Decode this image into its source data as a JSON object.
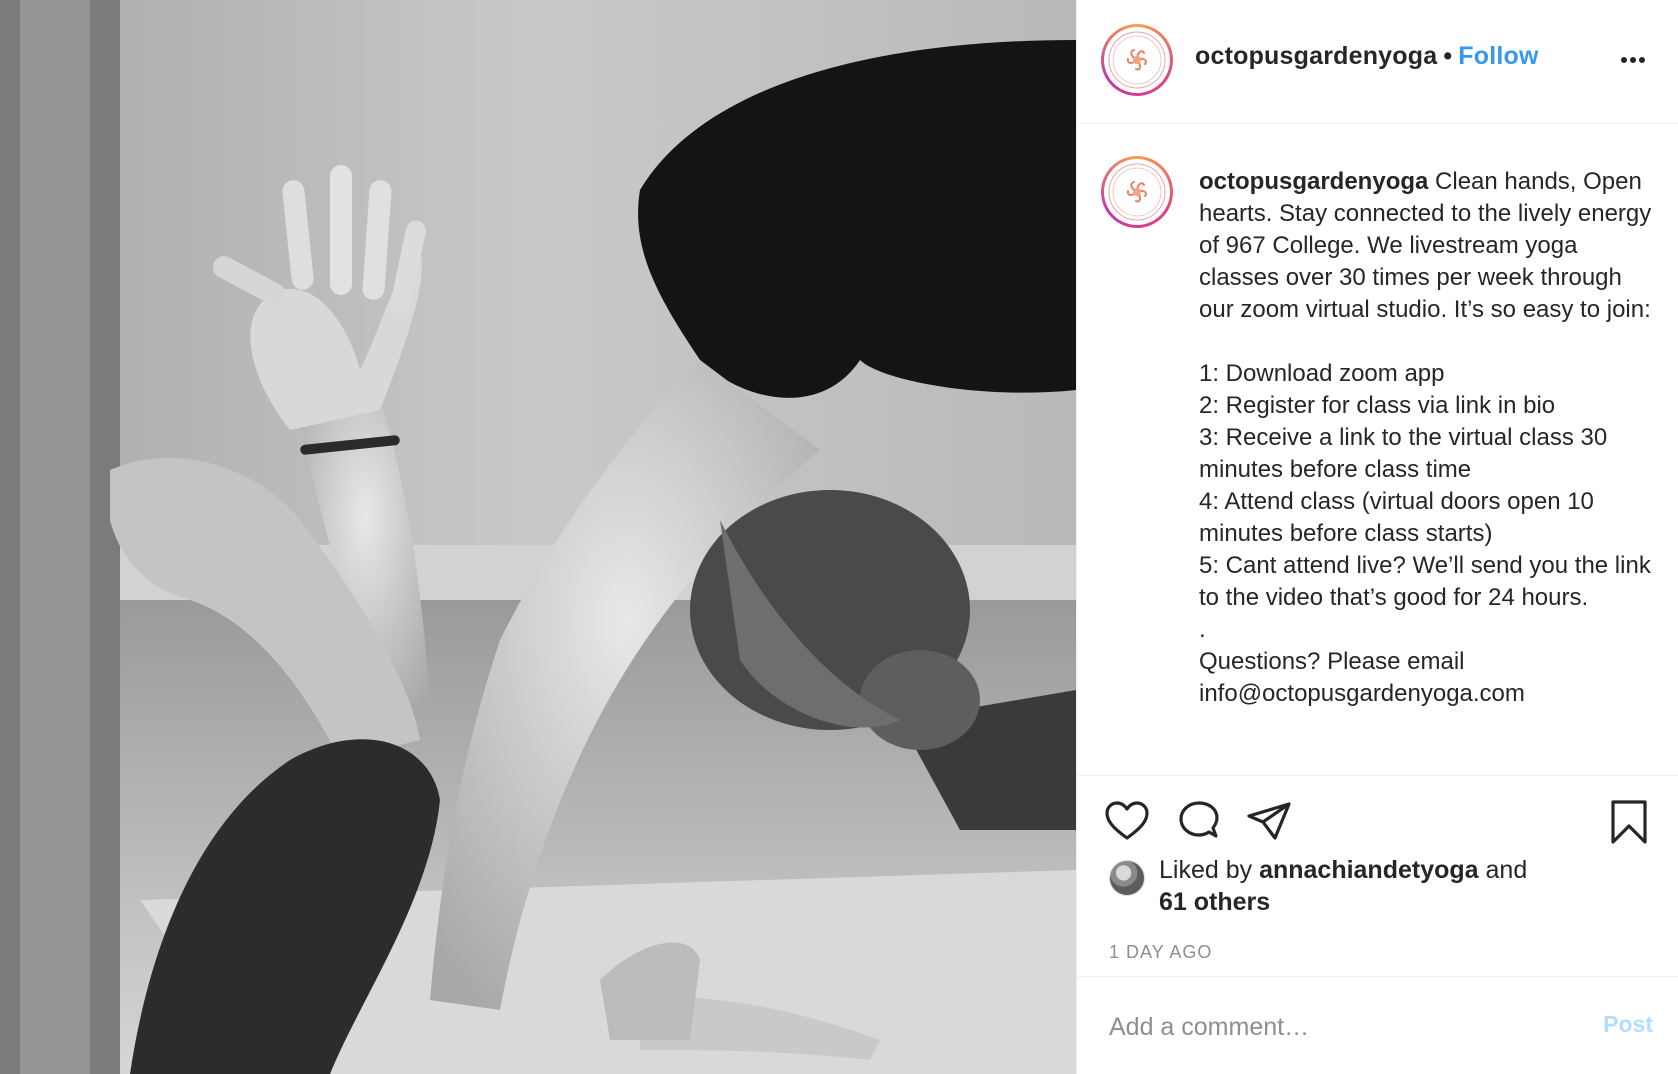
{
  "post": {
    "photo_alt": "",
    "username": "octopusgardenyoga",
    "separator": "•",
    "follow_label": "Follow",
    "caption_user": "octopusgardenyoga",
    "caption_body": " Clean hands, Open hearts. Stay connected to the lively energy of 967 College. We livestream yoga classes over 30 times per week through our zoom virtual studio. It’s so easy to join:\n\n1: Download zoom app\n2: Register for class via link in bio\n3: Receive a link to the virtual class 30 minutes before class time\n4: Attend class (virtual doors open 10 minutes before class starts)\n5: Cant attend live? We’ll send you the link to the video that’s good for 24 hours.\n.\nQuestions? Please email\ninfo@octopusgardenyoga.com",
    "liked_prefix": "Liked by ",
    "liked_user": "annachiandetyoga",
    "liked_middle": " and",
    "liked_others": "61 others",
    "timestamp": "1 DAY AGO",
    "comment_placeholder": "Add a comment…",
    "post_label": "Post"
  },
  "icons": {
    "more": "more-horizontal-icon",
    "like": "heart-icon",
    "comment": "comment-icon",
    "share": "share-icon",
    "save": "bookmark-icon"
  },
  "colors": {
    "link_blue": "#3897f0",
    "post_disabled": "#b2dffc",
    "muted": "#8e8e8e",
    "text": "#262626",
    "divider": "#efefef"
  }
}
